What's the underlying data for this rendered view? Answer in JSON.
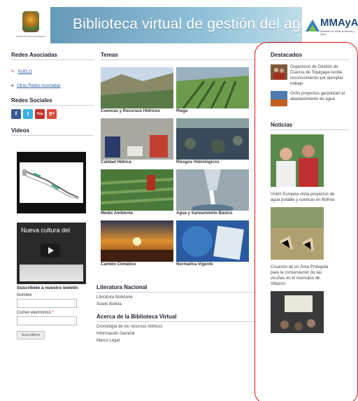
{
  "header": {
    "title": "Biblioteca virtual de gestión del agua",
    "coat_caption": "Estado Plurinacional de Bolivia",
    "mmaya_text": "MMAyA",
    "mmaya_sub": "Ministerio de Medio Ambiente y Agua"
  },
  "left": {
    "redes_asociadas": "Redes Asociadas",
    "links": [
      "SciELO",
      "Otras Redes Asociadas"
    ],
    "redes_sociales": "Redes Sociales",
    "social_icons": [
      {
        "name": "facebook-icon",
        "glyph": "f",
        "color": "#3b5998"
      },
      {
        "name": "twitter-icon",
        "glyph": "t",
        "color": "#3aaee0"
      },
      {
        "name": "youtube-icon",
        "glyph": "You",
        "color": "#c4302b"
      },
      {
        "name": "google-plus-icon",
        "glyph": "g+",
        "color": "#dd4b39"
      }
    ],
    "videos": "Videos",
    "video2_title": "Nueva cultura del",
    "subscribe_title": "Suscríbete a nuestro boletín",
    "name_label": "Nombre",
    "email_label": "Correo electrónico",
    "email_required": "*",
    "submit_label": "Suscribirse"
  },
  "mid": {
    "temas": "Temas",
    "tiles": [
      {
        "label": "Cuencas y Recursos Hídricos",
        "color": "#7a8a6a"
      },
      {
        "label": "Riego",
        "color": "#4a7a3a"
      },
      {
        "label": "Calidad Hídrica",
        "color": "#9a9a8a"
      },
      {
        "label": "Riesgos Hidrológicos",
        "color": "#3a4a5a"
      },
      {
        "label": "Medio Ambiente",
        "color": "#4a7a3a"
      },
      {
        "label": "Agua y Saneamiento Básico",
        "color": "#8a9aa0"
      },
      {
        "label": "Cambio Climático",
        "color": "#c07030"
      },
      {
        "label": "Normativa Vigente",
        "color": "#2a5aa0"
      }
    ],
    "literatura": "Literatura Nacional",
    "literatura_items": [
      "Literatura Boliviana",
      "Scielo Bolivia"
    ],
    "acerca": "Acerca de la Biblioteca Virtual",
    "acerca_items": [
      "Cronología de los recursos hídricos",
      "Información General",
      "Marco Legal"
    ]
  },
  "right": {
    "destacados": "Destacados",
    "dest_items": [
      "Organismo de Gestión de Cuenca de Tiquipaya recibe reconocimiento por ejemplar trabajo",
      "Ocho proyectos garantizan el abastecimiento de agua"
    ],
    "noticias": "Noticias",
    "news_items": [
      "Unión Europea visita proyectos de agua potable y cuencas en Bolivia",
      "Creación de un Área Protegida para la conservación de las vicuñas en el municipio de Villazón"
    ]
  }
}
